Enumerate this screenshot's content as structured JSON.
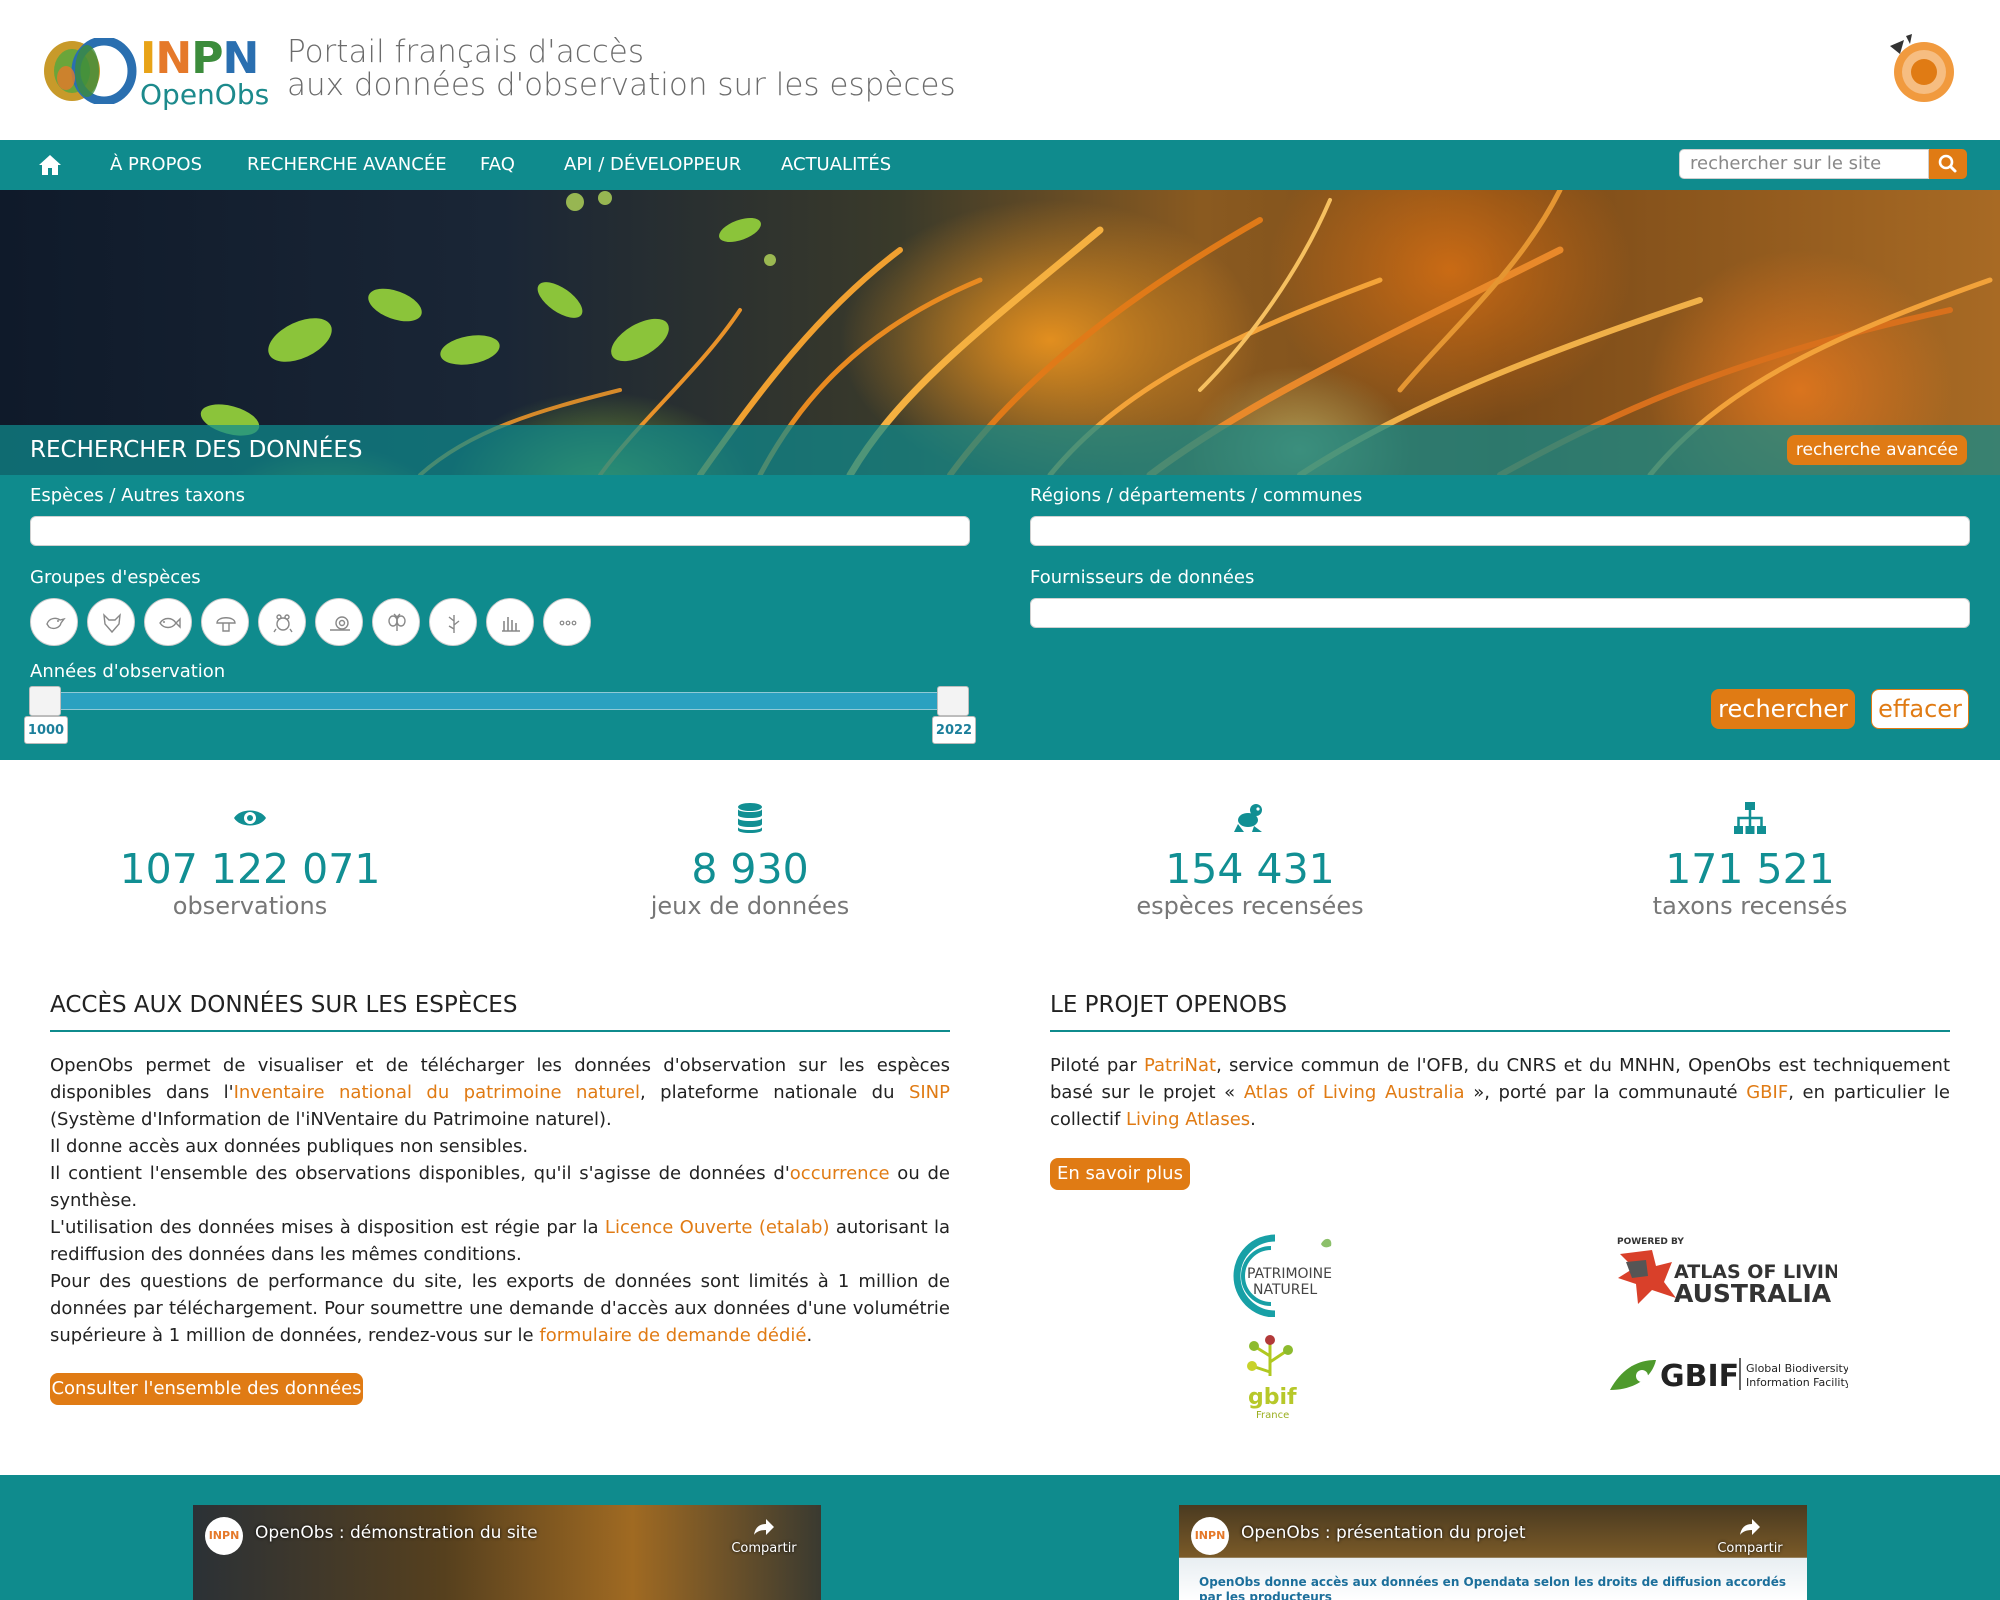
{
  "header": {
    "logo_mark": "INPN",
    "logo_sub": "OpenObs",
    "tagline_line1": "Portail français d'accès",
    "tagline_line2": "aux données d'observation sur les espèces"
  },
  "nav": {
    "home_icon": "home-icon",
    "items": [
      "À PROPOS",
      "RECHERCHE AVANCÉE",
      "FAQ",
      "API / DÉVELOPPEUR",
      "ACTUALITÉS"
    ],
    "search_placeholder": "rechercher sur le site",
    "search_icon": "search-icon"
  },
  "search": {
    "title": "RECHERCHER DES DONNÉES",
    "advanced_button": "recherche avancée",
    "species_label": "Espèces / Autres taxons",
    "species_value": "",
    "regions_label": "Régions / départements / communes",
    "regions_value": "",
    "groups_label": "Groupes d'espèces",
    "groups": [
      "bird-icon",
      "mammal-icon",
      "fish-icon",
      "fungi-icon",
      "amphibian-icon",
      "snail-icon",
      "insect-icon",
      "plant-icon",
      "bacteria-icon",
      "more-icon"
    ],
    "providers_label": "Fournisseurs de données",
    "providers_value": "",
    "years_label": "Années d'observation",
    "year_min": "1000",
    "year_max": "2022",
    "submit_button": "rechercher",
    "clear_button": "effacer"
  },
  "stats": [
    {
      "icon": "eye-icon",
      "value": "107 122 071",
      "label": "observations"
    },
    {
      "icon": "database-icon",
      "value": "8 930",
      "label": "jeux de données"
    },
    {
      "icon": "frog-icon",
      "value": "154 431",
      "label": "espèces recensées"
    },
    {
      "icon": "hierarchy-icon",
      "value": "171 521",
      "label": "taxons recensés"
    }
  ],
  "access": {
    "title": "ACCÈS AUX DONNÉES SUR LES ESPÈCES",
    "p1_a": "OpenObs permet de visualiser et de télécharger les données d'observation sur les espèces disponibles dans l'",
    "p1_link1": "Inventaire national du patrimoine naturel",
    "p1_b": ", plateforme nationale du ",
    "p1_link2": "SINP",
    "p1_c": " (Système d'Information de l'iNVentaire du Patrimoine naturel).",
    "p2": "Il donne accès aux données publiques non sensibles.",
    "p3_a": "Il contient l'ensemble des observations disponibles, qu'il s'agisse de données d'",
    "p3_link": "occurrence",
    "p3_b": " ou de synthèse.",
    "p4_a": "L'utilisation des données mises à disposition est régie par la ",
    "p4_link": "Licence Ouverte (etalab)",
    "p4_b": " autorisant la rediffusion des données dans les mêmes conditions.",
    "p5_a": "Pour des questions de performance du site, les exports de données sont limités à 1 million de données par téléchargement. Pour soumettre une demande d'accès aux données d'une volumétrie supérieure à 1 million de données, rendez-vous sur le ",
    "p5_link": "formulaire de demande dédié",
    "p5_b": ".",
    "button": "Consulter l'ensemble des données"
  },
  "project": {
    "title": "LE PROJET OPENOBS",
    "p_a": "Piloté par ",
    "p_link1": "PatriNat",
    "p_b": ", service commun de l'OFB, du CNRS et du MNHN, OpenObs est techniquement basé sur le projet « ",
    "p_link2": "Atlas of Living Australia",
    "p_c": " », porté par la communauté ",
    "p_link3": "GBIF",
    "p_d": ", en particulier le collectif ",
    "p_link4": "Living Atlases",
    "p_e": ".",
    "button": "En savoir plus",
    "partners": {
      "patrinat_line1": "PATRIMOINE",
      "patrinat_line2": "NATUREL",
      "ala_powered": "POWERED BY",
      "ala_line1": "ATLAS OF LIVING",
      "ala_line2": "AUSTRALIA",
      "gbif_fr": "gbif",
      "gbif_fr_sub": "France",
      "gbif_main": "GBIF",
      "gbif_sub1": "Global Biodiversity",
      "gbif_sub2": "Information Facility"
    }
  },
  "videos": [
    {
      "title": "OpenObs : démonstration du site",
      "share": "Compartir",
      "avatar": "INPN"
    },
    {
      "title": "OpenObs : présentation du projet",
      "share": "Compartir",
      "avatar": "INPN",
      "caption": "OpenObs donne accès aux données en Opendata selon les droits de diffusion accordés par les producteurs"
    }
  ],
  "colors": {
    "teal": "#0f8b8d",
    "orange": "#e07b14"
  }
}
